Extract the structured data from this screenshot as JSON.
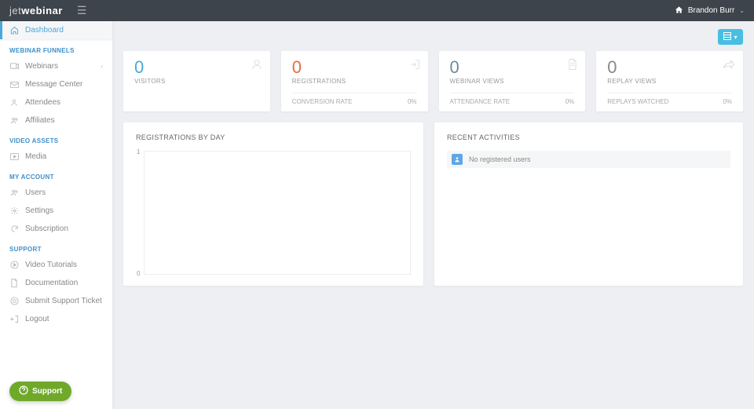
{
  "brand": {
    "thin": "jet",
    "bold": "webinar"
  },
  "user": {
    "name": "Brandon Burr"
  },
  "sidebar": {
    "dashboard": "Dashboard",
    "sections": {
      "funnels": "WEBINAR FUNNELS",
      "assets": "VIDEO ASSETS",
      "account": "MY ACCOUNT",
      "support": "SUPPORT"
    },
    "items": {
      "webinars": "Webinars",
      "message_center": "Message Center",
      "attendees": "Attendees",
      "affiliates": "Affiliates",
      "media": "Media",
      "users": "Users",
      "settings": "Settings",
      "subscription": "Subscription",
      "video_tutorials": "Video Tutorials",
      "documentation": "Documentation",
      "submit_ticket": "Submit Support Ticket",
      "logout": "Logout"
    }
  },
  "stats": [
    {
      "value": "0",
      "label": "VISITORS",
      "sub_label": "",
      "sub_value": ""
    },
    {
      "value": "0",
      "label": "REGISTRATIONS",
      "sub_label": "CONVERSION RATE",
      "sub_value": "0%"
    },
    {
      "value": "0",
      "label": "WEBINAR VIEWS",
      "sub_label": "ATTENDANCE RATE",
      "sub_value": "0%"
    },
    {
      "value": "0",
      "label": "REPLAY VIEWS",
      "sub_label": "REPLAYS WATCHED",
      "sub_value": "0%"
    }
  ],
  "panels": {
    "registrations_title": "REGISTRATIONS BY DAY",
    "activities_title": "RECENT ACTIVITIES",
    "no_users": "No registered users"
  },
  "chart_data": {
    "type": "line",
    "title": "REGISTRATIONS BY DAY",
    "xlabel": "",
    "ylabel": "",
    "ylim": [
      0,
      1
    ],
    "categories": [],
    "values": []
  },
  "support_btn": "Support"
}
